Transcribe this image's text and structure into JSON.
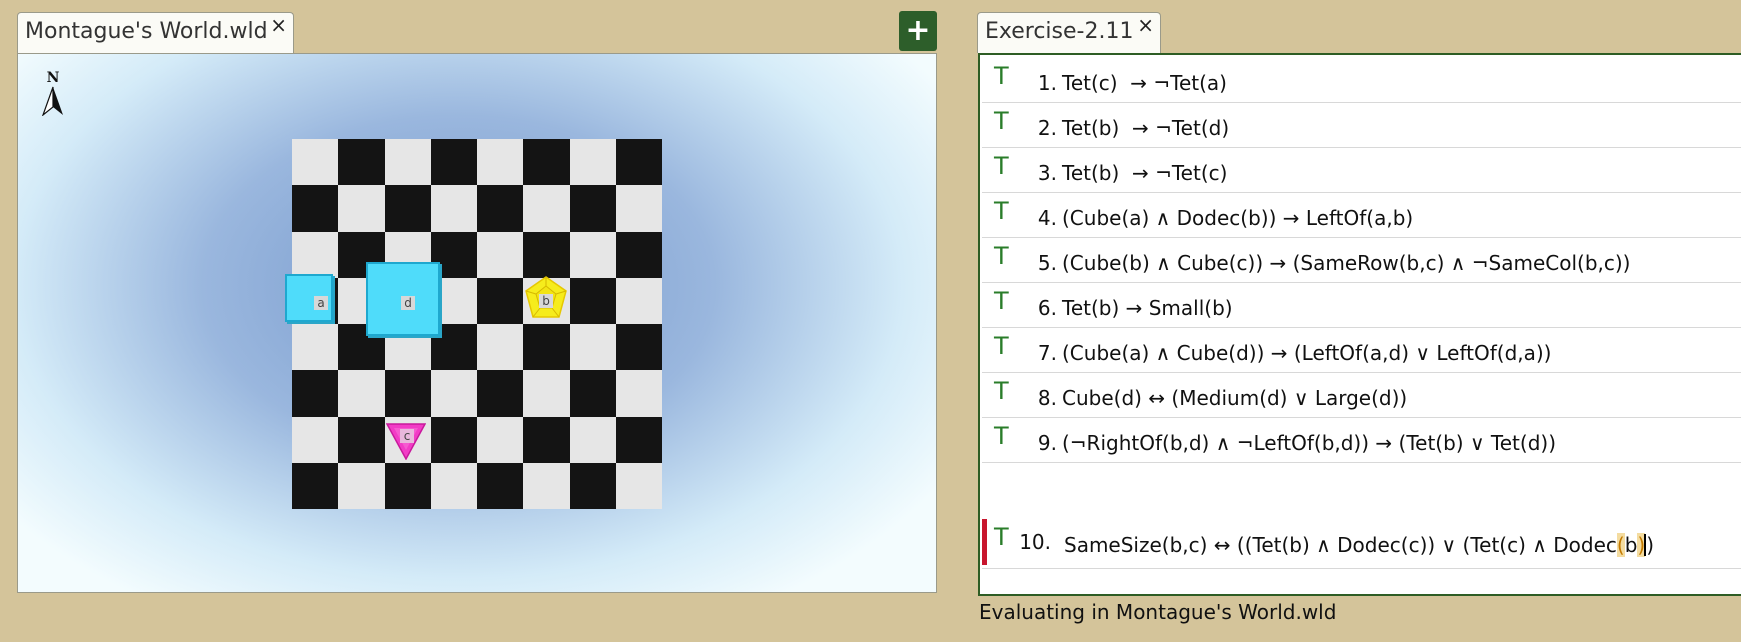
{
  "world_tab": {
    "title": "Montague's World.wld",
    "close": "×"
  },
  "add_button": {
    "label": "+"
  },
  "exercise_tab": {
    "title": "Exercise-2.11",
    "close": "×"
  },
  "compass": {
    "label": "N"
  },
  "blocks": [
    {
      "name": "a",
      "shape": "cube",
      "size": "small",
      "col": 0,
      "row": 3
    },
    {
      "name": "d",
      "shape": "cube",
      "size": "large",
      "col": 2,
      "row": 3
    },
    {
      "name": "b",
      "shape": "dodec",
      "size": "small",
      "col": 5,
      "row": 3
    },
    {
      "name": "c",
      "shape": "tet",
      "size": "small",
      "col": 2,
      "row": 6
    }
  ],
  "sentences": [
    {
      "number": "1.",
      "truth": "T",
      "formula": "Tet(c)  → ¬Tet(a)"
    },
    {
      "number": "2.",
      "truth": "T",
      "formula": "Tet(b)  → ¬Tet(d)"
    },
    {
      "number": "3.",
      "truth": "T",
      "formula": "Tet(b)  → ¬Tet(c)"
    },
    {
      "number": "4.",
      "truth": "T",
      "formula": "(Cube(a) ∧ Dodec(b)) → LeftOf(a,b)"
    },
    {
      "number": "5.",
      "truth": "T",
      "formula": "(Cube(b) ∧ Cube(c)) → (SameRow(b,c) ∧ ¬SameCol(b,c))"
    },
    {
      "number": "6.",
      "truth": "T",
      "formula": "Tet(b) → Small(b)"
    },
    {
      "number": "7.",
      "truth": "T",
      "formula": "(Cube(a) ∧ Cube(d)) → (LeftOf(a,d) ∨ LeftOf(d,a))"
    },
    {
      "number": "8.",
      "truth": "T",
      "formula": "Cube(d) ↔ (Medium(d) ∨ Large(d))"
    },
    {
      "number": "9.",
      "truth": "T",
      "formula": "(¬RightOf(b,d) ∧ ¬LeftOf(b,d)) → (Tet(b) ∨ Tet(d))"
    }
  ],
  "active_sentence": {
    "number": "10.",
    "truth": "T",
    "formula_start": "SameSize(b,c) ↔ ((Tet(b) ∧ Dodec(c)) ∨ (Tet(c) ∧ Dodec",
    "formula_hl1": "(",
    "formula_mid": "b",
    "formula_hl2": ")",
    "formula_end": ")"
  },
  "status": "Evaluating in Montague's World.wld",
  "colors": {
    "background": "#d4c49a",
    "cube": "#4fdcfa",
    "dodec": "#f6ec1c",
    "tet": "#f23cc6",
    "truth_true": "#2a7d2a",
    "active_marker": "#c8162e"
  }
}
